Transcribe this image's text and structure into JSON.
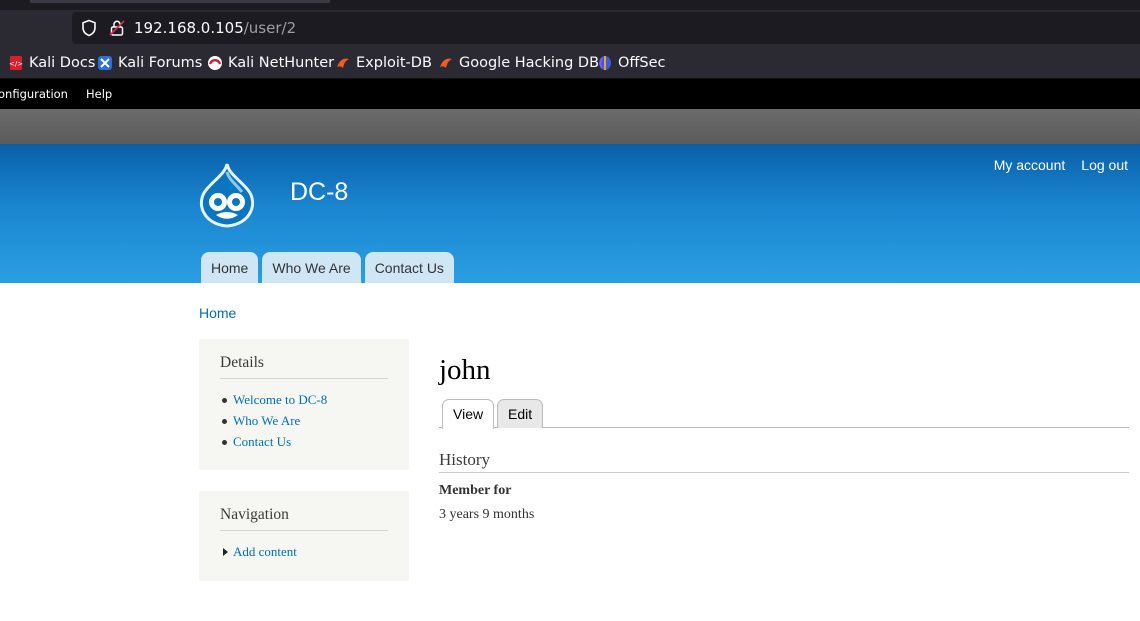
{
  "browser": {
    "url_host": "192.168.0.105",
    "url_path": "/user/2",
    "bookmarks": [
      "Kali Docs",
      "Kali Forums",
      "Kali NetHunter",
      "Exploit-DB",
      "Google Hacking DB",
      "OffSec"
    ]
  },
  "admin_bar": {
    "items": [
      "onfiguration",
      "Help"
    ]
  },
  "site": {
    "name": "DC-8",
    "secondary_menu": [
      "My account",
      "Log out"
    ],
    "main_menu": [
      "Home",
      "Who We Are",
      "Contact Us"
    ],
    "accent_color": "#0071b3"
  },
  "breadcrumb": "Home",
  "sidebar": {
    "details": {
      "title": "Details",
      "links": [
        "Welcome to DC-8",
        "Who We Are",
        "Contact Us"
      ]
    },
    "navigation": {
      "title": "Navigation",
      "links": [
        "Add content"
      ]
    }
  },
  "main": {
    "title": "john",
    "tabs": [
      "View",
      "Edit"
    ],
    "history_title": "History",
    "member_label": "Member for",
    "member_value": "3 years 9 months"
  }
}
